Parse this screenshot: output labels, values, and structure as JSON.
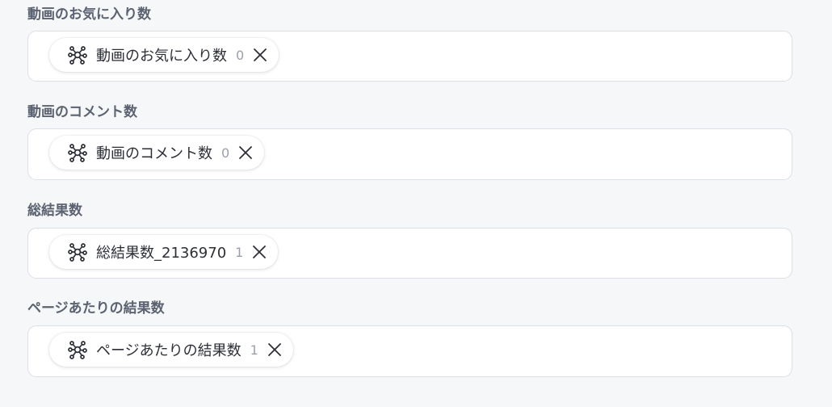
{
  "fields": [
    {
      "label": "動画のお気に入り数",
      "chip": {
        "label": "動画のお気に入り数",
        "count": "0",
        "icon": "variable-node-icon",
        "remove_icon": "close-icon"
      }
    },
    {
      "label": "動画のコメント数",
      "chip": {
        "label": "動画のコメント数",
        "count": "0",
        "icon": "variable-node-icon",
        "remove_icon": "close-icon"
      }
    },
    {
      "label": "総結果数",
      "chip": {
        "label": "総結果数_2136970",
        "count": "1",
        "icon": "variable-node-icon",
        "remove_icon": "close-icon"
      }
    },
    {
      "label": "ページあたりの結果数",
      "chip": {
        "label": "ページあたりの結果数",
        "count": "1",
        "icon": "variable-node-icon",
        "remove_icon": "close-icon"
      }
    }
  ],
  "colors": {
    "background": "#f6f7f9",
    "field_border": "#dcdfe5",
    "label_text": "#5b6270",
    "chip_text": "#2c2f36",
    "count_text": "#9aa0aa"
  }
}
